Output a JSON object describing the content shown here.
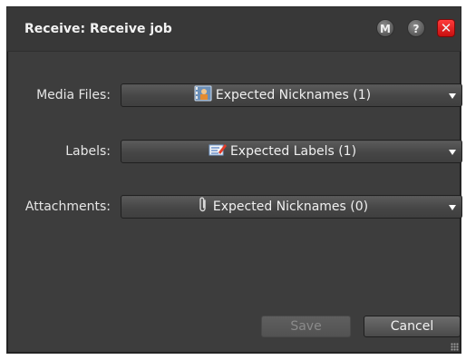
{
  "window": {
    "title": "Receive: Receive job",
    "buttons": {
      "m": "M",
      "help": "?",
      "close": "✕"
    }
  },
  "fields": [
    {
      "label": "Media Files:",
      "value": "Expected Nicknames (1)",
      "icon": "media-files-icon"
    },
    {
      "label": "Labels:",
      "value": "Expected Labels (1)",
      "icon": "labels-icon"
    },
    {
      "label": "Attachments:",
      "value": "Expected Nicknames (0)",
      "icon": "paperclip-icon"
    }
  ],
  "actions": {
    "save": "Save",
    "cancel": "Cancel"
  },
  "colors": {
    "dialog_bg": "#3d3d3d",
    "close_red": "#e02020",
    "text": "#f0f0f0"
  }
}
